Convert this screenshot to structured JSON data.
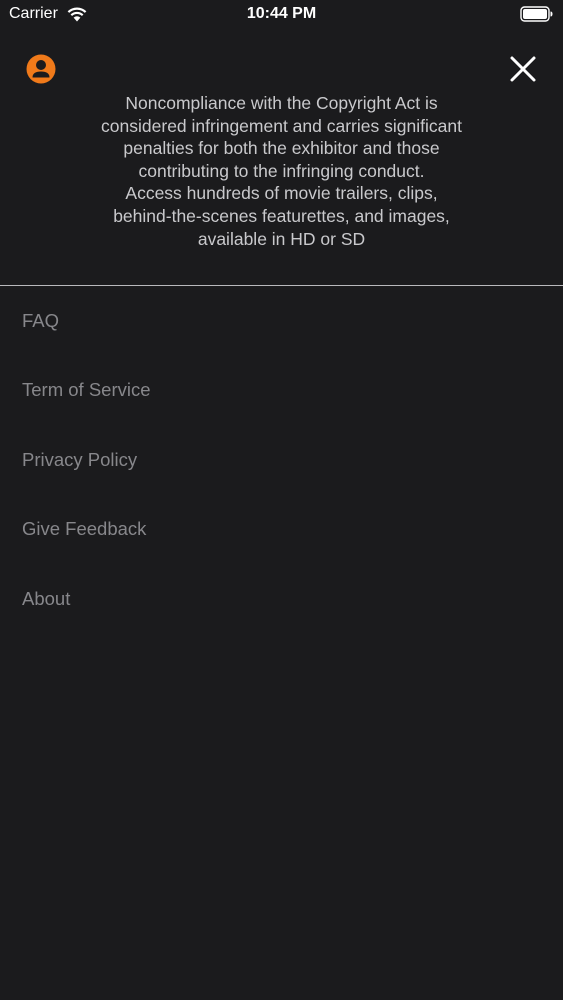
{
  "status_bar": {
    "carrier": "Carrier",
    "time": "10:44 PM",
    "icons": [
      "wifi-icon",
      "battery-icon"
    ]
  },
  "header": {
    "avatar_icon": "user-avatar-icon",
    "close_icon": "close-icon",
    "description": "Noncompliance with the Copyright Act is\nconsidered infringement and carries significant\npenalties for both the exhibitor and those\ncontributing to the infringing conduct.\nAccess hundreds of movie trailers, clips,\nbehind-the-scenes featurettes, and images,\navailable in HD or SD"
  },
  "menu": {
    "items": [
      {
        "label": "FAQ"
      },
      {
        "label": "Term of Service"
      },
      {
        "label": "Privacy Policy"
      },
      {
        "label": "Give Feedback"
      },
      {
        "label": "About"
      }
    ]
  },
  "colors": {
    "background": "#1b1b1d",
    "accent": "#f07a1a",
    "description_text": "#c9c9cc",
    "menu_text": "#87878b",
    "divider": "#b9b9bc"
  }
}
